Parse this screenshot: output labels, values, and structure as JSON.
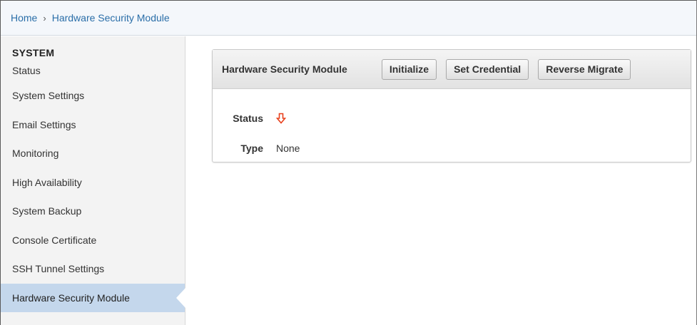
{
  "breadcrumb": {
    "home": "Home",
    "separator": "›",
    "current": "Hardware Security Module"
  },
  "sidebar": {
    "heading": "SYSTEM",
    "items": [
      {
        "label": "Status"
      },
      {
        "label": "System Settings"
      },
      {
        "label": "Email Settings"
      },
      {
        "label": "Monitoring"
      },
      {
        "label": "High Availability"
      },
      {
        "label": "System Backup"
      },
      {
        "label": "Console Certificate"
      },
      {
        "label": "SSH Tunnel Settings"
      },
      {
        "label": "Hardware Security Module"
      }
    ],
    "active_index": 8
  },
  "panel": {
    "title": "Hardware Security Module",
    "buttons": {
      "initialize": "Initialize",
      "set_credential": "Set Credential",
      "reverse_migrate": "Reverse Migrate"
    },
    "fields": {
      "status_label": "Status",
      "status_icon": "down-arrow-icon",
      "type_label": "Type",
      "type_value": "None"
    }
  },
  "colors": {
    "link": "#2a6ea8",
    "active_item_bg": "#c4d7ec",
    "status_down": "#e8401c"
  }
}
